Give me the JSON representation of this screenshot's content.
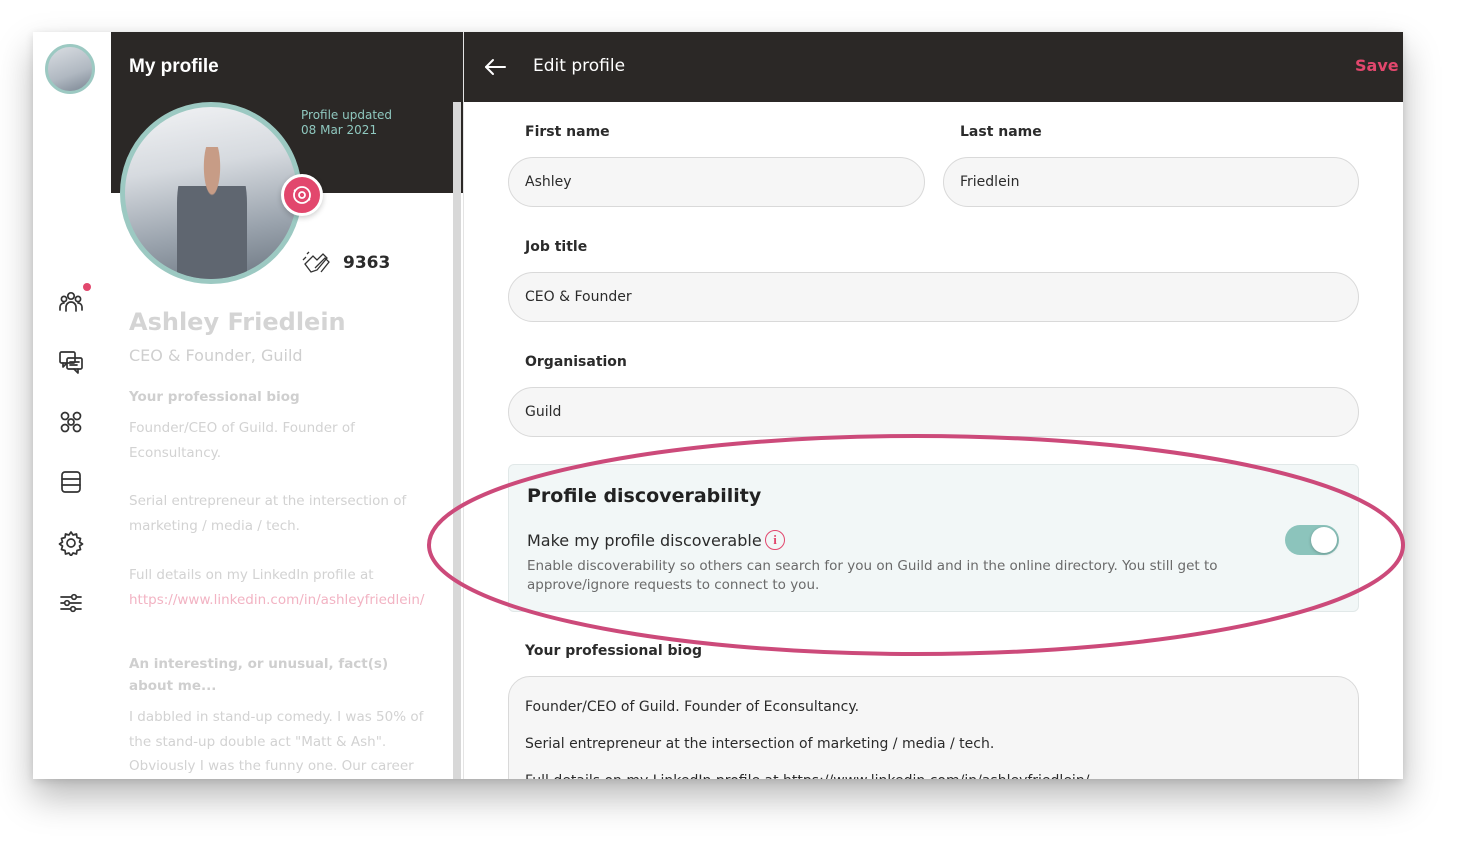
{
  "rail": {
    "icons": [
      "people-icon",
      "chat-icon",
      "groups-icon",
      "list-icon",
      "gear-icon",
      "sliders-icon"
    ]
  },
  "profile": {
    "title": "My profile",
    "updated_label": "Profile updated",
    "updated_date": "08 Mar 2021",
    "claps_count": "9363",
    "name": "Ashley Friedlein",
    "role": "CEO & Founder, Guild",
    "bio_heading": "Your professional biog",
    "bio_line1": "Founder/CEO of Guild. Founder of Econsultancy.",
    "bio_line2": "Serial entrepreneur at the intersection of marketing / media / tech.",
    "bio_line3": "Full details on my LinkedIn profile at",
    "bio_link": "https://www.linkedin.com/in/ashleyfriedlein/",
    "fact_heading": "An interesting, or unusual, fact(s) about me...",
    "fact_text": "I dabbled in stand-up comedy. I was 50% of the stand-up double act \"Matt & Ash\". Obviously I was the funny one. Our career"
  },
  "edit": {
    "title": "Edit profile",
    "save_label": "Save",
    "first_name_label": "First name",
    "first_name_value": "Ashley",
    "last_name_label": "Last name",
    "last_name_value": "Friedlein",
    "job_title_label": "Job title",
    "job_title_value": "CEO & Founder",
    "org_label": "Organisation",
    "org_value": "Guild",
    "discoverability": {
      "title": "Profile discoverability",
      "toggle_label": "Make my profile discoverable",
      "info_glyph": "i",
      "description": "Enable discoverability so others can search for you on Guild and in the online directory. You still get to approve/ignore requests to connect to you.",
      "enabled": true
    },
    "bio_label": "Your professional biog",
    "bio_lines": [
      "Founder/CEO of Guild. Founder of Econsultancy.",
      "Serial entrepreneur at the intersection of marketing / media / tech.",
      "Full details on my LinkedIn profile at https://www.linkedin.com/in/ashleyfriedlein/"
    ]
  },
  "colors": {
    "header_bg": "#2b2826",
    "accent_pink": "#e2476d",
    "accent_teal": "#8cc4bc",
    "annotation": "#cc4a7a"
  }
}
